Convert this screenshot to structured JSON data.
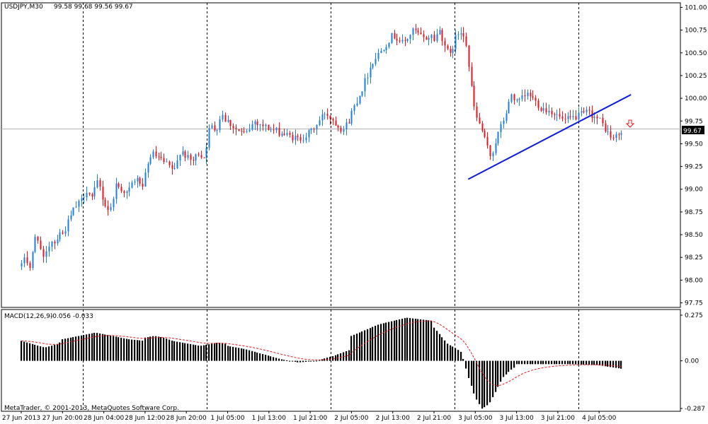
{
  "colors": {
    "background": "#ffffff",
    "frame": "#000000",
    "grid": "#000000",
    "bull": "#1e7ee6",
    "bear": "#e8141e",
    "trendline": "#0a1adf",
    "macd_hist": "#000000",
    "macd_signal": "#e8141e",
    "price_line": "#b4b4b4",
    "marker": "#e8141e"
  },
  "header": {
    "symbol": "USDJPY,M30",
    "ohlc": "99.58 99.68 99.56 99.67"
  },
  "macd_header": {
    "label": "MACD(12,26,9)",
    "values": "-0.056 -0.033"
  },
  "price_tag": "99.67",
  "footer": {
    "copyright": "MetaTrader, © 2001-2013, MetaQuotes Software Corp."
  },
  "icons": {
    "sell_marker": "down-arrow-icon"
  },
  "chart_data": [
    {
      "type": "candlestick",
      "title": "USDJPY,M30",
      "ylim": [
        97.7,
        101.05
      ],
      "y_ticks": [
        "101.00",
        "100.75",
        "100.50",
        "100.25",
        "100.00",
        "99.75",
        "99.50",
        "99.25",
        "99.00",
        "98.75",
        "98.50",
        "98.25",
        "98.00",
        "97.75"
      ],
      "x_ticks": [
        "27 Jun 2013",
        "27 Jun 20:00",
        "28 Jun 04:00",
        "28 Jun 12:00",
        "28 Jun 20:00",
        "1 Jul 05:00",
        "1 Jul 13:00",
        "1 Jul 21:00",
        "2 Jul 05:00",
        "2 Jul 13:00",
        "2 Jul 21:00",
        "3 Jul 05:00",
        "3 Jul 13:00",
        "3 Jul 21:00",
        "4 Jul 05:00"
      ],
      "day_separators_after_tick": [
        "27 Jun 20:00",
        "28 Jun 20:00",
        "1 Jul 21:00",
        "2 Jul 21:00",
        "3 Jul 21:00"
      ],
      "current_price": 99.67,
      "anchors": [
        [
          98.15,
          98.3,
          98.1,
          98.3,
          98.55,
          98.35,
          98.2,
          98.35,
          98.45,
          98.4,
          98.55,
          98.5
        ],
        [
          98.5,
          98.65,
          98.8,
          98.85,
          99.0,
          98.9,
          99.1,
          98.85,
          98.75,
          99.05,
          99.0,
          98.95,
          99.1,
          99.1,
          98.9
        ],
        [
          99.15,
          99.4,
          99.35,
          99.3,
          99.25,
          99.2,
          99.45,
          99.35,
          99.3,
          99.4,
          99.35,
          99.7,
          99.65,
          99.85,
          99.7
        ],
        [
          99.75,
          99.65,
          99.6,
          99.75,
          99.7,
          99.65,
          99.62,
          99.58,
          99.55,
          99.6,
          99.7,
          99.85,
          99.75,
          99.65,
          99.8
        ],
        [
          99.85,
          100.1,
          100.4,
          100.55,
          100.7,
          100.6,
          100.75,
          100.65,
          100.7
        ],
        [
          100.65,
          100.75,
          100.6,
          100.45,
          100.65,
          100.75,
          100.7,
          100.2,
          99.8,
          99.7,
          99.5,
          99.35,
          99.55,
          99.7,
          99.85,
          100.05,
          99.95
        ],
        [
          99.95,
          100.05,
          99.9,
          99.85,
          99.75,
          99.8,
          99.85,
          99.75,
          99.55,
          99.65
        ]
      ],
      "segment_ticks": [
        [
          0,
          1
        ],
        [
          1,
          3
        ],
        [
          3,
          5
        ],
        [
          5,
          8
        ],
        [
          8,
          10
        ],
        [
          10,
          12
        ],
        [
          12,
          14.6
        ]
      ],
      "trendline": {
        "from": {
          "x": "3 Jul 05:00",
          "y": 99.11
        },
        "to": {
          "x": "4 Jul 05:00",
          "y": 100.04
        }
      }
    },
    {
      "type": "histogram",
      "title": "MACD(12,26,9)",
      "ylim": [
        -0.287,
        0.275
      ],
      "y_ticks": [
        "0.275",
        "0.00",
        "-0.287"
      ],
      "macd_latest": -0.056,
      "signal_latest": -0.033,
      "anchors": [
        [
          0.12,
          0.11,
          0.1,
          0.09,
          0.08,
          0.09,
          0.1,
          0.12
        ],
        [
          0.13,
          0.15,
          0.17,
          0.15,
          0.13,
          0.12
        ],
        [
          0.14,
          0.15,
          0.14,
          0.12,
          0.11,
          0.1,
          0.09,
          0.1,
          0.11,
          0.1
        ],
        [
          0.09,
          0.07,
          0.04,
          0.01,
          -0.01,
          0.0,
          0.03,
          0.07
        ],
        [
          0.15,
          0.22,
          0.26,
          0.24
        ],
        [
          0.2,
          0.15,
          0.1,
          0.08,
          0.05,
          -0.1,
          -0.22,
          -0.29,
          -0.26,
          -0.18,
          -0.1,
          -0.06,
          -0.03
        ],
        [
          -0.02,
          -0.02,
          -0.02,
          -0.025,
          -0.05
        ]
      ]
    }
  ]
}
